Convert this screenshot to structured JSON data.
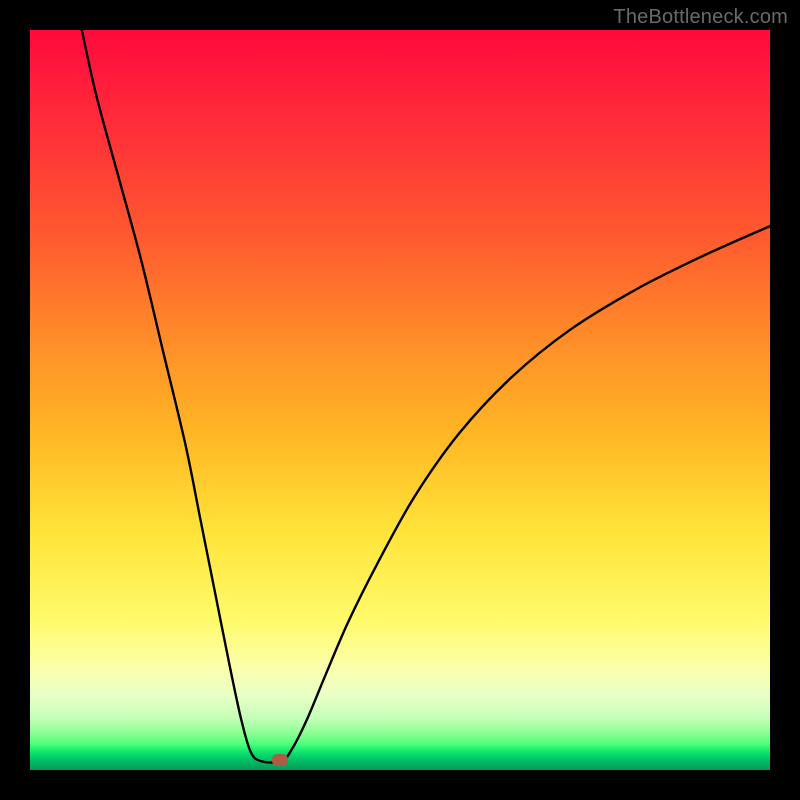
{
  "watermark": "TheBottleneck.com",
  "colors": {
    "frame": "#000000",
    "curve_stroke": "#000000",
    "marker": "#b05a48"
  },
  "chart_data": {
    "type": "line",
    "title": "",
    "xlabel": "",
    "ylabel": "",
    "xlim": [
      0,
      100
    ],
    "ylim": [
      0,
      100
    ],
    "grid": false,
    "series": [
      {
        "name": "left-branch",
        "x": [
          7.0,
          9.0,
          12.0,
          15.0,
          18.0,
          21.0,
          23.0,
          25.0,
          27.0,
          28.5,
          29.8,
          31.2
        ],
        "values": [
          100,
          91.0,
          80.0,
          69.0,
          56.5,
          44.0,
          34.0,
          24.0,
          14.0,
          7.0,
          2.5,
          1.2
        ]
      },
      {
        "name": "right-branch",
        "x": [
          34.0,
          35.5,
          37.5,
          40.0,
          43.0,
          47.0,
          52.0,
          58.0,
          65.0,
          73.0,
          82.0,
          91.0,
          100.0
        ],
        "values": [
          1.2,
          3.0,
          7.0,
          13.0,
          20.0,
          28.0,
          37.0,
          45.5,
          53.0,
          59.5,
          65.0,
          69.5,
          73.5
        ]
      },
      {
        "name": "floor",
        "x": [
          31.2,
          34.0
        ],
        "values": [
          1.2,
          1.2
        ]
      }
    ],
    "marker": {
      "x": 33.8,
      "y": 1.4
    },
    "gradient_stops": [
      {
        "pos": 0,
        "color": "#ff0a3c"
      },
      {
        "pos": 12,
        "color": "#ff2b3a"
      },
      {
        "pos": 28,
        "color": "#ff5a2f"
      },
      {
        "pos": 42,
        "color": "#ff8d28"
      },
      {
        "pos": 55,
        "color": "#ffb824"
      },
      {
        "pos": 68,
        "color": "#ffe43a"
      },
      {
        "pos": 80,
        "color": "#fffb6c"
      },
      {
        "pos": 86,
        "color": "#fcffab"
      },
      {
        "pos": 90,
        "color": "#e8ffc6"
      },
      {
        "pos": 93,
        "color": "#c4ffb8"
      },
      {
        "pos": 95,
        "color": "#8bff93"
      },
      {
        "pos": 96.5,
        "color": "#4dff7a"
      },
      {
        "pos": 97.5,
        "color": "#0fe86f"
      },
      {
        "pos": 98.2,
        "color": "#03d06a"
      },
      {
        "pos": 99,
        "color": "#04b562"
      },
      {
        "pos": 100,
        "color": "#059a56"
      }
    ]
  }
}
